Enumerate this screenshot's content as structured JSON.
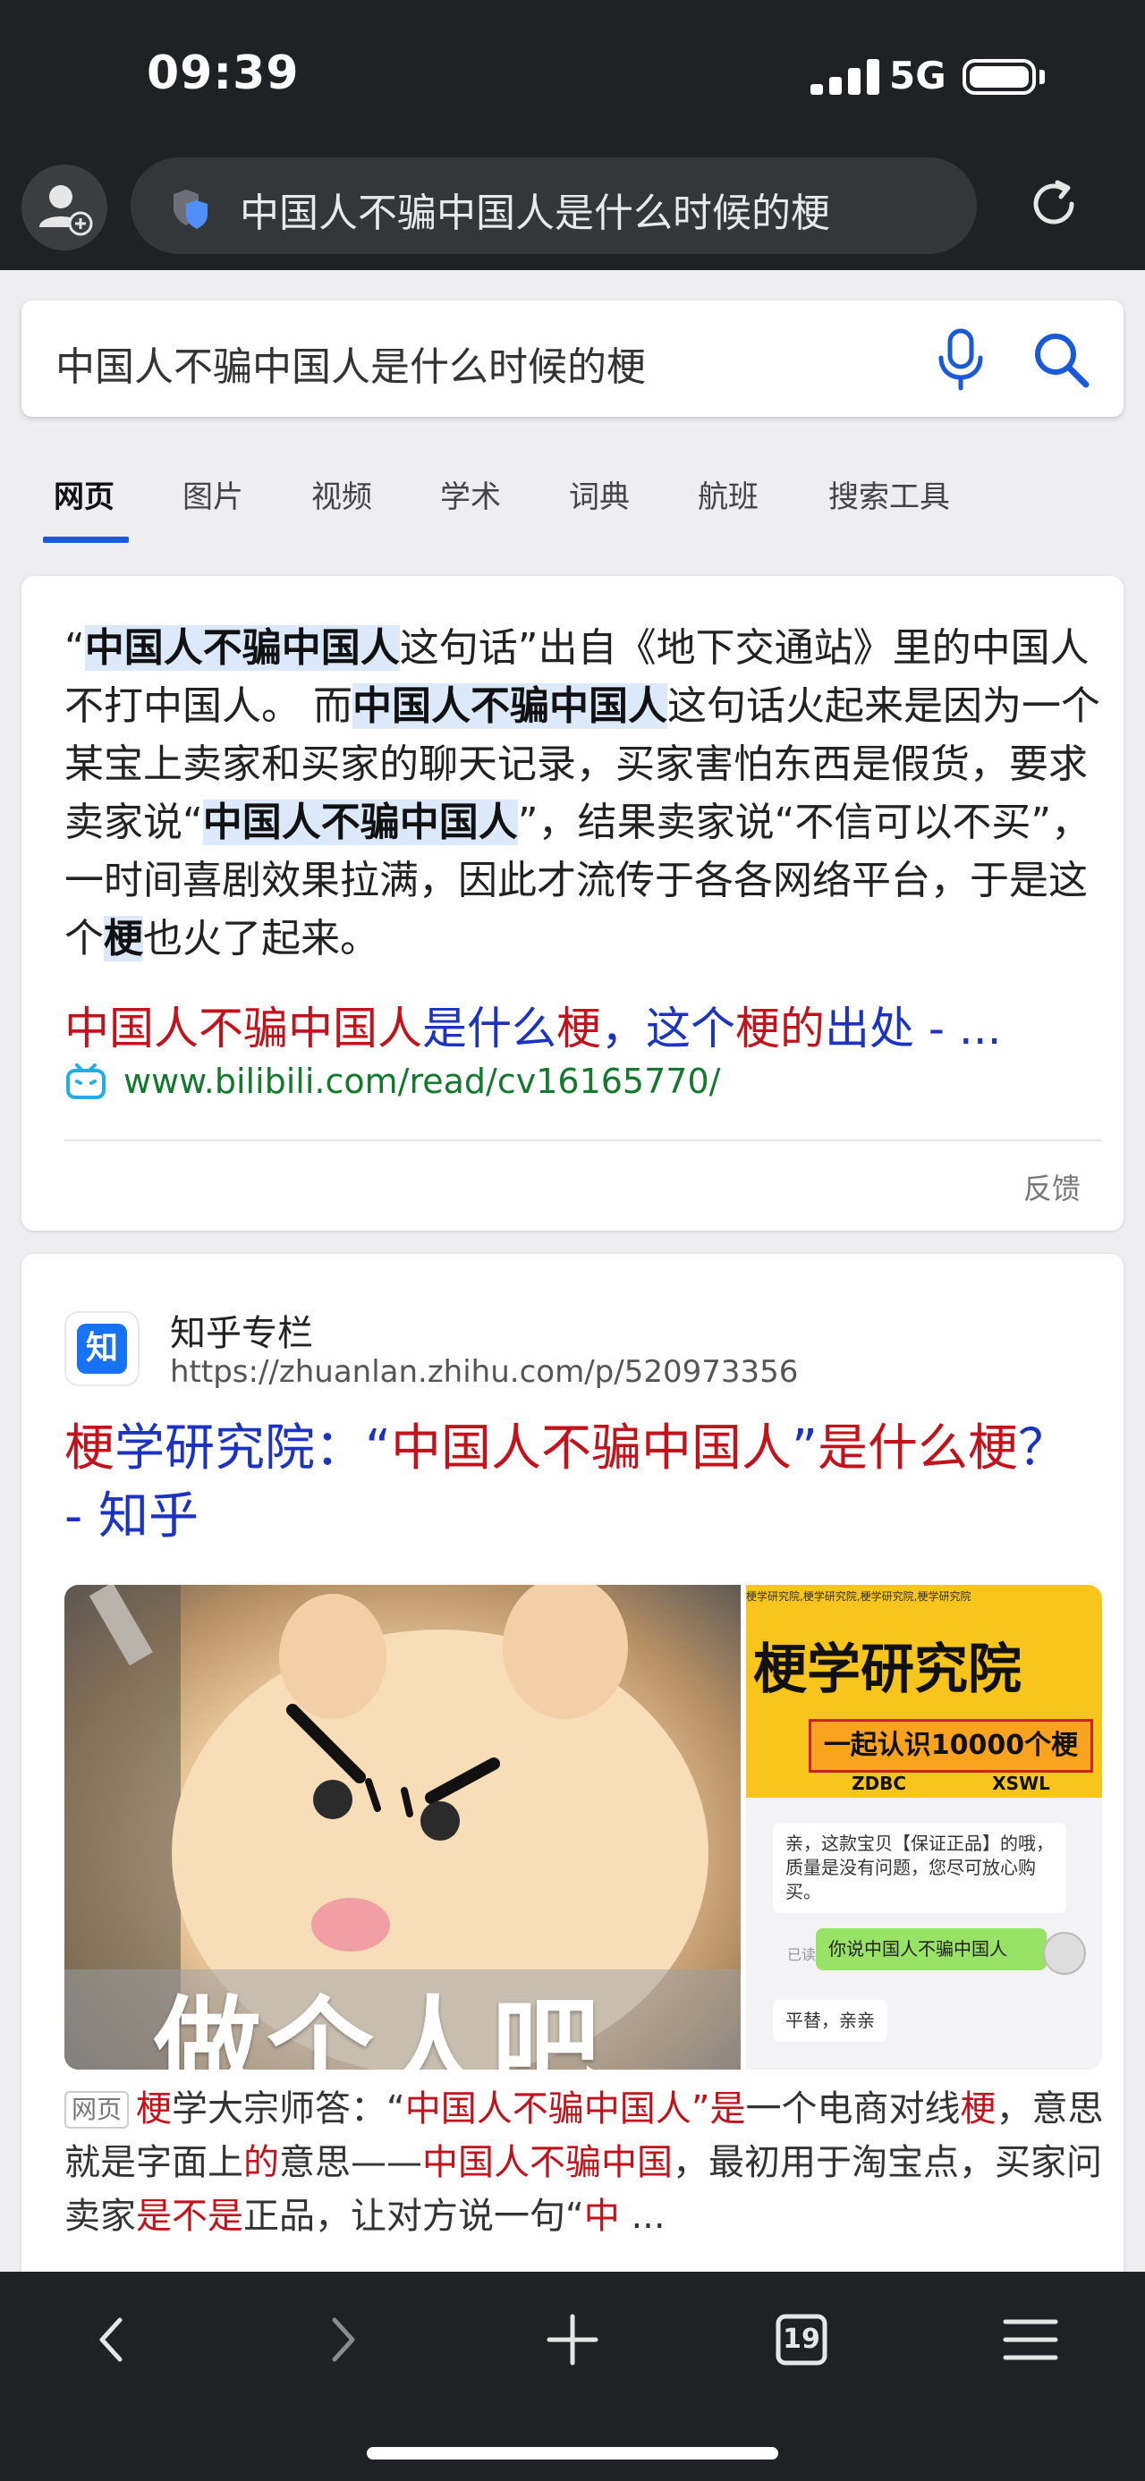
{
  "status_bar": {
    "time": "09:39",
    "network": "5G"
  },
  "browser": {
    "url_text": "中国人不骗中国人是什么时候的梗",
    "tabs_count": "19"
  },
  "search": {
    "query": "中国人不骗中国人是什么时候的梗"
  },
  "tabs": [
    {
      "label": "网页",
      "active": true
    },
    {
      "label": "图片"
    },
    {
      "label": "视频"
    },
    {
      "label": "学术"
    },
    {
      "label": "词典"
    },
    {
      "label": "航班"
    },
    {
      "label": "搜索工具"
    }
  ],
  "answer_card": {
    "snippet_parts": [
      "“",
      "中国人不骗中国人",
      "这句话”出自《地下交通站》里的中国人不打中国人。 而",
      "中国人不骗中国人",
      "这句话火起来是因为一个某宝上卖家和买家的聊天记录，买家害怕东西是假货，要求卖家说“",
      "中国人不骗中国人",
      "”，结果卖家说“不信可以不买”，一时间喜剧效果拉满，因此才流传于各各网络平台，于是这个",
      "梗",
      "也火了起来。"
    ],
    "source_title_parts": [
      "中国人不骗中国人",
      "是什么",
      "梗",
      "，",
      "这个",
      "梗",
      "的",
      "出处",
      " - ..."
    ],
    "source_url": "www.bilibili.com/read/cv16165770/",
    "feedback": "反馈"
  },
  "result": {
    "site_name": "知乎专栏",
    "site_url": "https://zhuanlan.zhihu.com/p/520973356",
    "logo_text": "知",
    "title_parts": [
      "梗",
      "学研究院：“",
      "中国人不骗中国人",
      "”",
      "是什么",
      "梗",
      "？ - 知乎"
    ],
    "image1_caption": "做个人吧",
    "image2": {
      "title": "梗学研究院",
      "strip": "一起认识10000个梗",
      "tags": [
        "ZDBC",
        "XSWL"
      ],
      "header_text": "梗学研究院,梗学研究院,梗学研究院,梗学研究院",
      "chat": [
        "亲，这款宝贝【保证正品】的哦，质量是没有问题，您尽可放心购买。",
        "你说中国人不骗中国人",
        "平替，亲亲"
      ],
      "read_tag": "已读"
    },
    "desc_tag": "网页",
    "desc_parts": [
      "梗",
      "学大宗师答：“",
      "中国人不骗中国人",
      "”",
      "是",
      "一个电商对线",
      "梗",
      "，意思就是字面上",
      "的",
      "意思——",
      "中国人不骗中国",
      "，最初用于淘宝点，买家问卖家",
      "是不是",
      "正品，让对方说一句“",
      "中",
      " ..."
    ]
  }
}
